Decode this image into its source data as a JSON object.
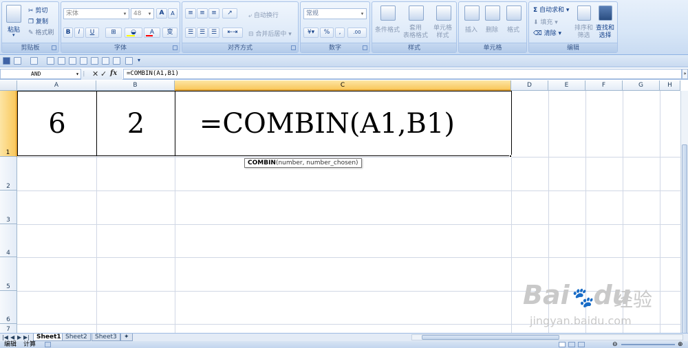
{
  "ribbon": {
    "clipboard": {
      "label": "剪贴板",
      "paste": "粘贴",
      "cut": "剪切",
      "copy": "复制",
      "format_painter": "格式刷"
    },
    "font": {
      "label": "字体",
      "font_name": "宋体",
      "font_size": "48",
      "bold": "B",
      "italic": "I",
      "underline": "U",
      "grow": "A",
      "shrink": "A",
      "font_color": "A",
      "phonetic": "变"
    },
    "alignment": {
      "label": "对齐方式",
      "wrap_text": "自动换行",
      "merge_center": "合并后居中"
    },
    "number": {
      "label": "数字",
      "format": "常规",
      "currency": "%",
      "percent": "%",
      "comma": ",",
      "inc_dec": ".00"
    },
    "styles": {
      "label": "样式",
      "conditional": "条件格式",
      "table_format_1": "套用",
      "table_format_2": "表格格式",
      "cell_styles_1": "单元格",
      "cell_styles_2": "样式"
    },
    "cells": {
      "label": "单元格",
      "insert": "插入",
      "delete": "删除",
      "format": "格式"
    },
    "editing": {
      "label": "编辑",
      "autosum": "自动求和",
      "fill": "填充",
      "clear": "清除",
      "sort_1": "排序和",
      "sort_2": "筛选",
      "find_1": "查找和",
      "find_2": "选择"
    }
  },
  "formula_bar": {
    "name_box": "AND",
    "cancel": "✕",
    "enter": "✓",
    "fx": "fx",
    "formula": "=COMBIN(A1,B1)"
  },
  "grid": {
    "columns": [
      "A",
      "B",
      "C",
      "D",
      "E",
      "F",
      "G",
      "H"
    ],
    "rows": [
      "1",
      "2",
      "3",
      "4",
      "5",
      "6",
      "7"
    ],
    "cells": {
      "A1": "6",
      "B1": "2",
      "C1": "=COMBIN(A1,B1)"
    },
    "tooltip": {
      "func": "COMBIN",
      "args": "(number, number_chosen)"
    }
  },
  "sheets": [
    "Sheet1",
    "Sheet2",
    "Sheet3"
  ],
  "active_sheet": "Sheet1",
  "status": {
    "mode": "编辑",
    "calc": "计算"
  },
  "watermark": {
    "brand": "Bai",
    "brand2": "du",
    "cn": "经验",
    "url": "jingyan.baidu.com"
  },
  "colors": {
    "ribbon_bg": "#dbe7f6",
    "selected_header": "#f9c85d",
    "grid_line": "#d0d7e5"
  }
}
